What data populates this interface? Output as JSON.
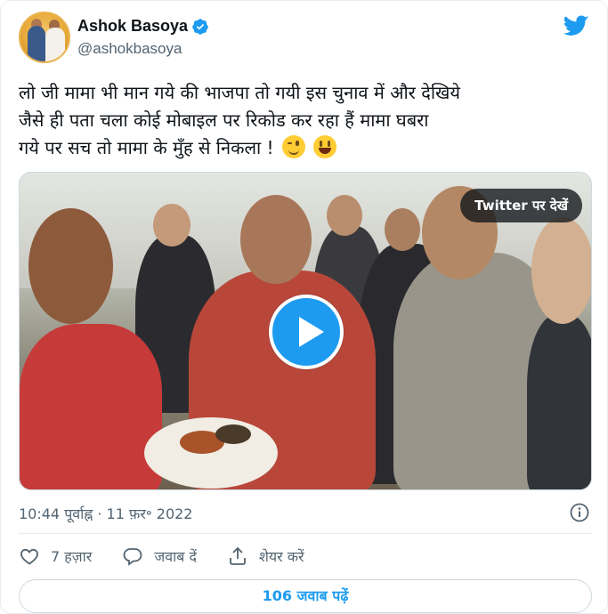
{
  "author": {
    "name": "Ashok Basoya",
    "handle": "@ashokbasoya",
    "verified": true
  },
  "brand": {
    "logo_icon": "twitter-bird-icon",
    "accent": "#1d9bf0"
  },
  "tweet": {
    "text_line1": "लो जी मामा भी मान गये की भाजपा तो गयी इस चुनाव में और देखिये",
    "text_line2": "जैसे ही पता चला कोई मोबाइल पर रिकोड कर रहा हैं मामा घबरा",
    "text_line3": "गये पर सच तो मामा के मुँह से निकला !",
    "emojis": [
      "winking-face-emoji",
      "grinning-face-emoji"
    ]
  },
  "media": {
    "type": "video",
    "watch_label": "Twitter पर देखें",
    "play_icon": "play-icon"
  },
  "meta": {
    "timestamp": "10:44 पूर्वाह्न · 11 फ़र॰ 2022",
    "info_icon": "info-icon"
  },
  "actions": {
    "like_count": "7 हज़ार",
    "reply_label": "जवाब दें",
    "share_label": "शेयर करें"
  },
  "replies_button": "106 जवाब पढ़ें"
}
